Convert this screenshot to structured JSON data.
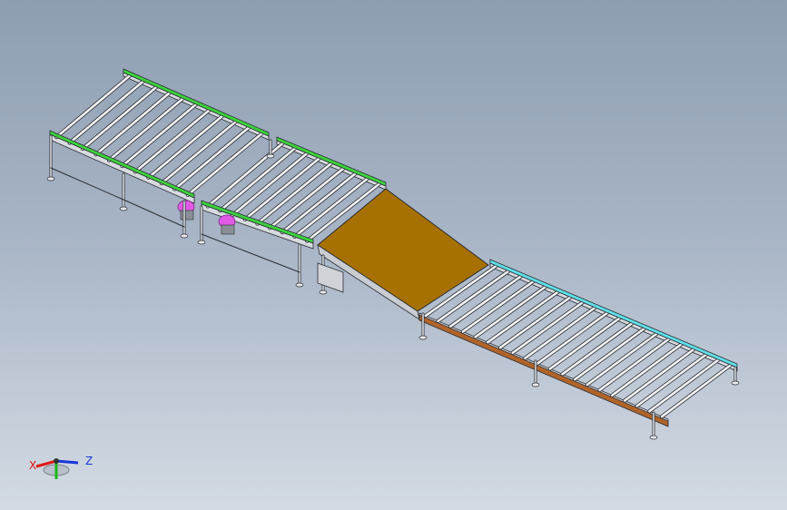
{
  "viewport": {
    "background_top": "#8e9db1",
    "background_bottom": "#d3dae3"
  },
  "model": {
    "colors": {
      "frame": "#d7dbe0",
      "frame_edge": "#2a2d33",
      "roller": "#f3f4f6",
      "green_guide": "#3cd23c",
      "cyan_guide": "#5fe0e8",
      "incline_plate": "#a67100",
      "motor": "#e05ae6",
      "brown_rail": "#b0642a"
    }
  },
  "triad": {
    "x_label": "X",
    "z_label": "Z",
    "x_color": "#e01818",
    "y_color": "#18b818",
    "z_color": "#1836d6"
  }
}
